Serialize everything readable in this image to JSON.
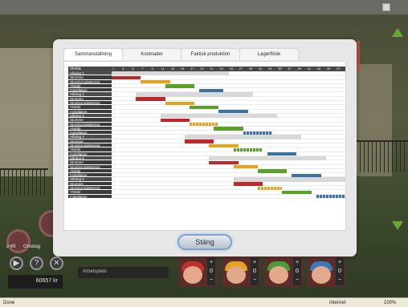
{
  "game": {
    "week_label": "v 49",
    "day_label": "Onsdag",
    "money": "60657 kr",
    "work_field": "Arbetsplats",
    "controls": [
      "▶",
      "?",
      "✕"
    ],
    "workers": [
      {
        "hat_color": "#c0302a",
        "count": "0"
      },
      {
        "hat_color": "#e4a321",
        "count": "0"
      },
      {
        "hat_color": "#4c9a3c",
        "count": "0"
      },
      {
        "hat_color": "#3a78b8",
        "count": "0"
      }
    ],
    "plus": "+",
    "minus": "−"
  },
  "dialog": {
    "tabs": [
      "Sammanställning",
      "Kostnader",
      "Faktisk produktion",
      "Lagerflöde"
    ],
    "active_tab": 0,
    "close_label": "Stäng"
  },
  "gantt": {
    "header_label": "Vecka",
    "weeks": [
      "1",
      "3",
      "5",
      "7",
      "9",
      "11",
      "13",
      "15",
      "17",
      "19",
      "21",
      "23",
      "25",
      "27",
      "29",
      "31",
      "33",
      "35",
      "37",
      "39",
      "41",
      "43",
      "45",
      "47"
    ],
    "total_weeks": 48,
    "colors": {
      "Stomme": "#c0272d",
      "Stomkomplettering": "#e4a321",
      "Ytskikt": "#5aa02c",
      "Installation": "#3e6fa5"
    },
    "floors": [
      {
        "label": "Våning 1",
        "span": [
          1,
          24
        ],
        "tasks": [
          {
            "name": "Stomme",
            "start": 1,
            "end": 6,
            "dashed": false
          },
          {
            "name": "Stomkomplettering",
            "start": 7,
            "end": 12,
            "dashed": false
          },
          {
            "name": "Ytskikt",
            "start": 12,
            "end": 17,
            "dashed": false
          },
          {
            "name": "Installation",
            "start": 19,
            "end": 23,
            "dashed": false
          }
        ]
      },
      {
        "label": "Våning 2",
        "span": [
          6,
          29
        ],
        "tasks": [
          {
            "name": "Stomme",
            "start": 6,
            "end": 11,
            "dashed": false
          },
          {
            "name": "Stomkomplettering",
            "start": 12,
            "end": 17,
            "dashed": false
          },
          {
            "name": "Ytskikt",
            "start": 17,
            "end": 22,
            "dashed": false
          },
          {
            "name": "Installation",
            "start": 23,
            "end": 28,
            "dashed": false
          }
        ]
      },
      {
        "label": "Våning 3",
        "span": [
          11,
          34
        ],
        "tasks": [
          {
            "name": "Stomme",
            "start": 11,
            "end": 16,
            "dashed": false
          },
          {
            "name": "Stomkomplettering",
            "start": 17,
            "end": 22,
            "dashed": true
          },
          {
            "name": "Ytskikt",
            "start": 22,
            "end": 27,
            "dashed": false
          },
          {
            "name": "Installation",
            "start": 28,
            "end": 33,
            "dashed": true
          }
        ]
      },
      {
        "label": "Våning 4",
        "span": [
          16,
          39
        ],
        "tasks": [
          {
            "name": "Stomme",
            "start": 16,
            "end": 21,
            "dashed": false
          },
          {
            "name": "Stomkomplettering",
            "start": 21,
            "end": 26,
            "dashed": false
          },
          {
            "name": "Ytskikt",
            "start": 26,
            "end": 31,
            "dashed": true
          },
          {
            "name": "Installation",
            "start": 33,
            "end": 38,
            "dashed": false
          }
        ]
      },
      {
        "label": "Våning 5",
        "span": [
          21,
          44
        ],
        "tasks": [
          {
            "name": "Stomme",
            "start": 21,
            "end": 26,
            "dashed": false
          },
          {
            "name": "Stomkomplettering",
            "start": 26,
            "end": 30,
            "dashed": false
          },
          {
            "name": "Ytskikt",
            "start": 31,
            "end": 36,
            "dashed": false
          },
          {
            "name": "Installation",
            "start": 38,
            "end": 43,
            "dashed": false
          }
        ]
      },
      {
        "label": "Våning 6",
        "span": [
          26,
          48
        ],
        "tasks": [
          {
            "name": "Stomme",
            "start": 26,
            "end": 31,
            "dashed": false
          },
          {
            "name": "Stomkomplettering",
            "start": 31,
            "end": 35,
            "dashed": true
          },
          {
            "name": "Ytskikt",
            "start": 36,
            "end": 41,
            "dashed": false
          },
          {
            "name": "Installation",
            "start": 43,
            "end": 48,
            "dashed": true
          }
        ]
      }
    ]
  },
  "statusbar": {
    "left": "Done",
    "zone": "Internet",
    "zoom": "100%"
  }
}
